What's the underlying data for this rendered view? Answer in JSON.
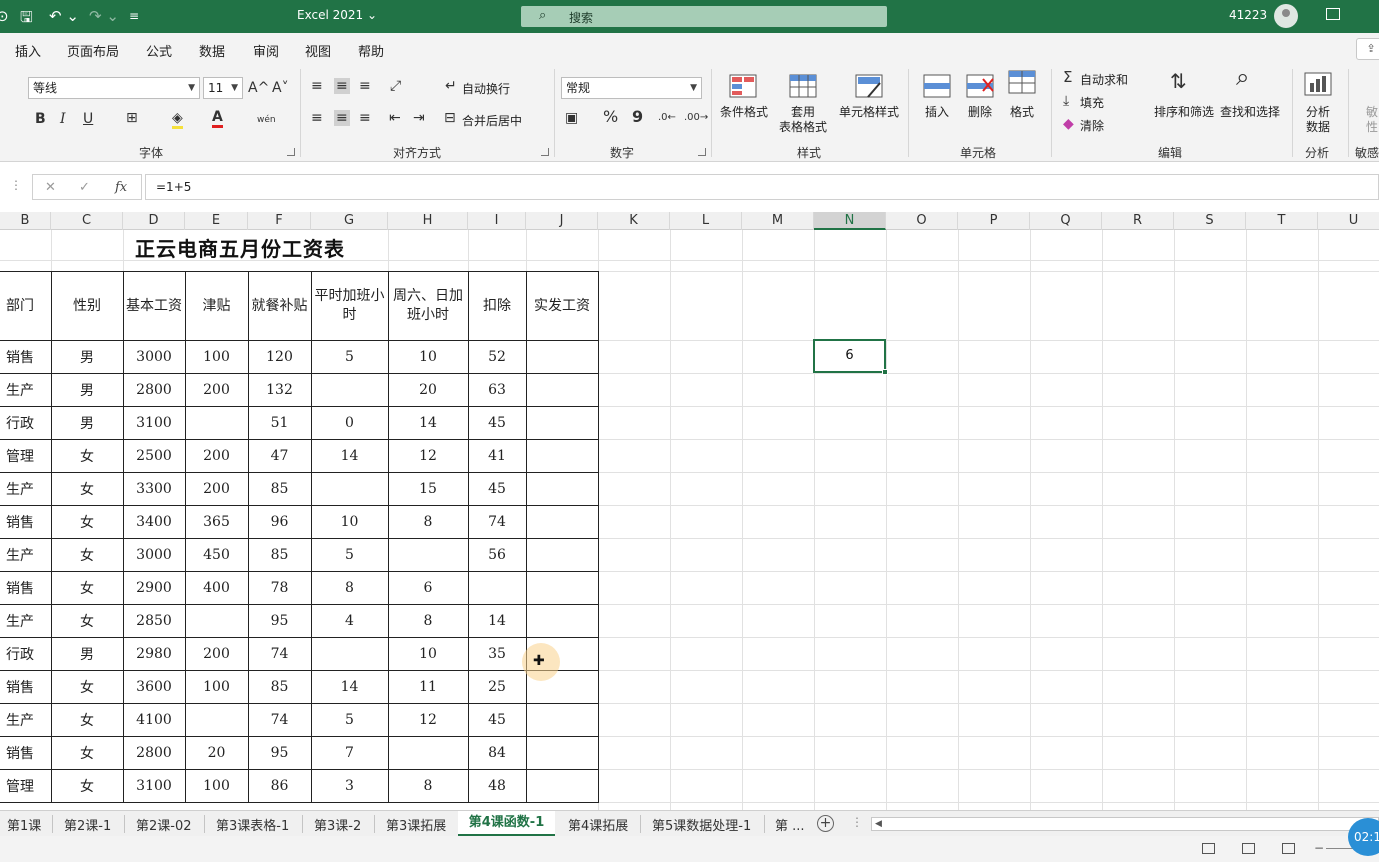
{
  "titlebar": {
    "app_title": "Excel 2021 ⌄",
    "search_placeholder": "搜索",
    "user_id": "41223",
    "qa_items": [
      "⊙",
      "🖫",
      "↶ ⌄",
      "↷ ⌄",
      "≡"
    ]
  },
  "menu": {
    "tabs": [
      "插入",
      "页面布局",
      "公式",
      "数据",
      "审阅",
      "视图",
      "帮助"
    ]
  },
  "ribbon": {
    "font": {
      "group_label": "字体",
      "font_name": "等线",
      "font_size": "11",
      "grow": "A^",
      "shrink": "A˅",
      "bold": "B",
      "italic": "I",
      "underline": "U",
      "phonetic": "wén"
    },
    "alignment": {
      "group_label": "对齐方式",
      "wrap_text": "自动换行",
      "merge_center": "合并后居中"
    },
    "number": {
      "group_label": "数字",
      "format": "常规",
      "percent": "%",
      "comma": "9"
    },
    "styles": {
      "group_label": "样式",
      "conditional": "条件格式",
      "table_format_1": "套用",
      "table_format_2": "表格格式",
      "cell_styles": "单元格样式"
    },
    "cells": {
      "group_label": "单元格",
      "insert": "插入",
      "delete": "删除",
      "format": "格式"
    },
    "editing": {
      "group_label": "编辑",
      "autosum": "自动求和",
      "fill": "填充",
      "clear": "清除",
      "sort_filter": "排序和筛选",
      "find_select": "查找和选择"
    },
    "analysis": {
      "group_label": "分析",
      "analyze_1": "分析",
      "analyze_2": "数据"
    },
    "sensitivity": {
      "group_label": "敏感",
      "label_1": "敏",
      "label_2": "性"
    }
  },
  "formula_bar": {
    "cancel": "✕",
    "confirm": "✓",
    "fx": "fx",
    "formula": "=1+5"
  },
  "columns": [
    "B",
    "C",
    "D",
    "E",
    "F",
    "G",
    "H",
    "I",
    "J",
    "K",
    "L",
    "M",
    "N",
    "O",
    "P",
    "Q",
    "R",
    "S",
    "T",
    "U"
  ],
  "sheet": {
    "title": "正云电商五月份工资表",
    "headers": [
      "部门",
      "性别",
      "基本工资",
      "津贴",
      "就餐补贴",
      "平时加班小时",
      "周六、日加班小时",
      "扣除",
      "实发工资"
    ],
    "rows": [
      [
        "销售",
        "男",
        "3000",
        "100",
        "120",
        "5",
        "10",
        "52",
        ""
      ],
      [
        "生产",
        "男",
        "2800",
        "200",
        "132",
        "",
        "20",
        "63",
        ""
      ],
      [
        "行政",
        "男",
        "3100",
        "",
        "51",
        "0",
        "14",
        "45",
        ""
      ],
      [
        "管理",
        "女",
        "2500",
        "200",
        "47",
        "14",
        "12",
        "41",
        ""
      ],
      [
        "生产",
        "女",
        "3300",
        "200",
        "85",
        "",
        "15",
        "45",
        ""
      ],
      [
        "销售",
        "女",
        "3400",
        "365",
        "96",
        "10",
        "8",
        "74",
        ""
      ],
      [
        "生产",
        "女",
        "3000",
        "450",
        "85",
        "5",
        "",
        "56",
        ""
      ],
      [
        "销售",
        "女",
        "2900",
        "400",
        "78",
        "8",
        "6",
        "",
        ""
      ],
      [
        "生产",
        "女",
        "2850",
        "",
        "95",
        "4",
        "8",
        "14",
        ""
      ],
      [
        "行政",
        "男",
        "2980",
        "200",
        "74",
        "",
        "10",
        "35",
        ""
      ],
      [
        "销售",
        "女",
        "3600",
        "100",
        "85",
        "14",
        "11",
        "25",
        ""
      ],
      [
        "生产",
        "女",
        "4100",
        "",
        "74",
        "5",
        "12",
        "45",
        ""
      ],
      [
        "销售",
        "女",
        "2800",
        "20",
        "95",
        "7",
        "",
        "84",
        ""
      ],
      [
        "管理",
        "女",
        "3100",
        "100",
        "86",
        "3",
        "8",
        "48",
        ""
      ]
    ],
    "selected_value": "6"
  },
  "sheet_tabs": {
    "tabs": [
      "第1课",
      "第2课-1",
      "第2课-02",
      "第3课表格-1",
      "第3课-2",
      "第3课拓展",
      "第4课函数-1",
      "第4课拓展",
      "第5课数据处理-1",
      "第 ..."
    ],
    "active": "第4课函数-1",
    "add": "+"
  },
  "status": {
    "timer": "02:1"
  },
  "colors": {
    "accent": "#217346"
  }
}
